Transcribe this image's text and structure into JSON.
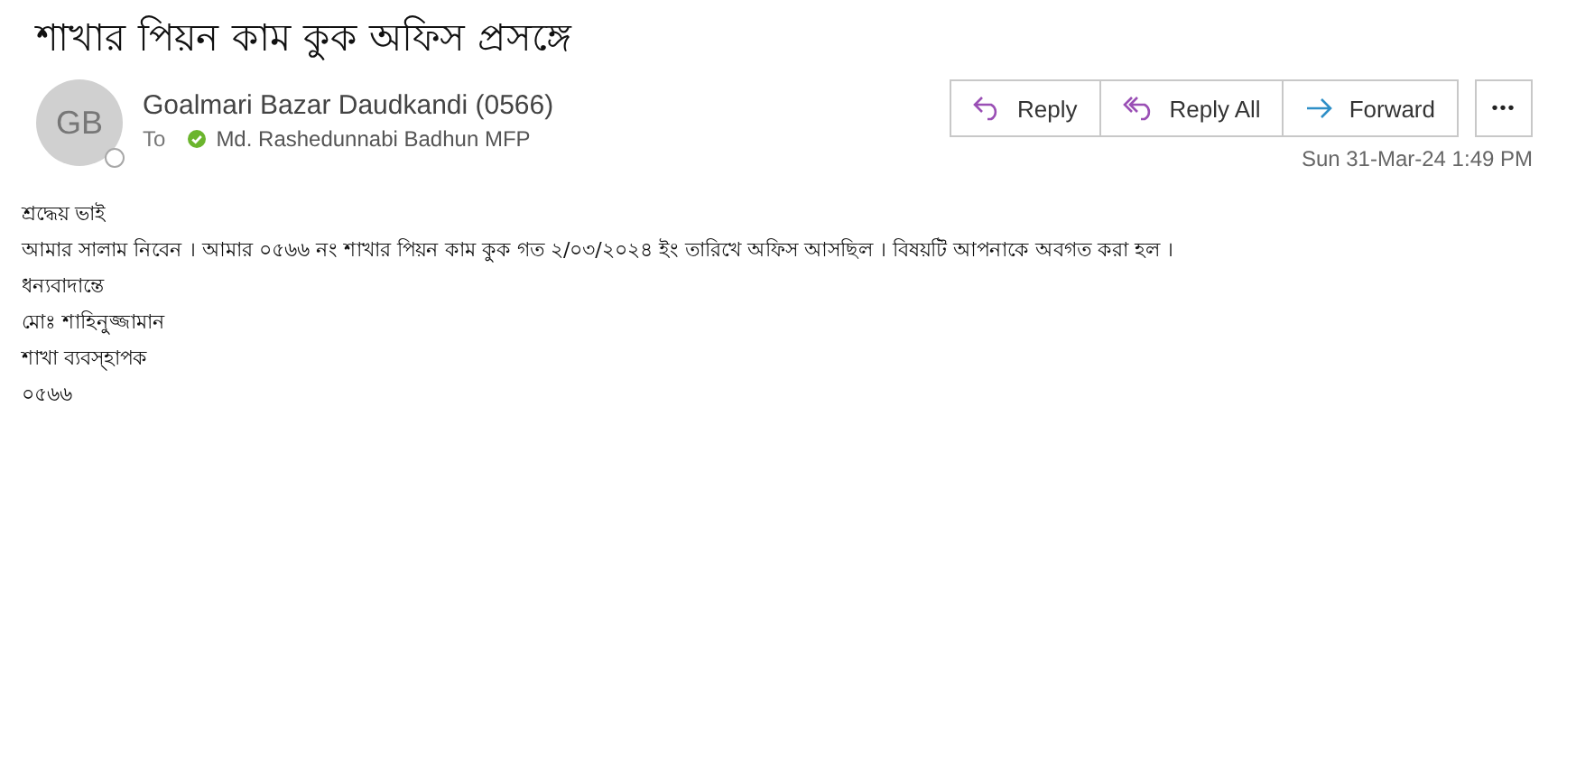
{
  "subject": "শাখার পিয়ন কাম কুক অফিস প্রসঙ্গে",
  "sender": {
    "initials": "GB",
    "name": "Goalmari Bazar Daudkandi (0566)"
  },
  "to_label": "To",
  "recipients": [
    {
      "name": "Md. Rashedunnabi Badhun MFP"
    }
  ],
  "actions": [
    {
      "kind": "reply",
      "label": "Reply"
    },
    {
      "kind": "reply_all",
      "label": "Reply All"
    },
    {
      "kind": "forward",
      "label": "Forward"
    }
  ],
  "more_button": "•••",
  "date": "Sun 31-Mar-24 1:49 PM",
  "body": [
    "শ্রদ্ধেয় ভাই",
    "আমার সালাম নিবেন । আমার ০৫৬৬ নং শাখার পিয়ন কাম কুক গত ২/০৩/২০২৪ ইং তারিখে অফিস আসছিল । বিষয়টি আপনাকে অবগত করা হল ।",
    "ধন্যবাদান্তে",
    "মোঃ শাহিনুজ্জামান",
    "শাখা ব্যবস্হাপক",
    "০৫৬৬"
  ]
}
